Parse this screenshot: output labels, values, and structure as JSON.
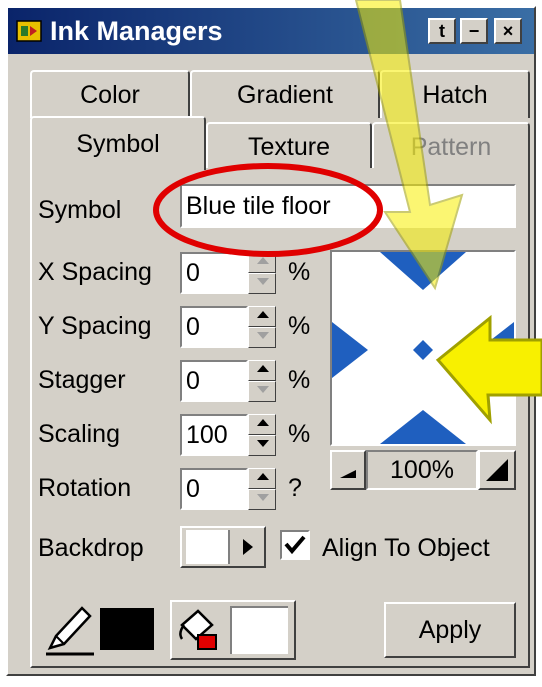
{
  "window": {
    "title": "Ink Managers",
    "icons": {
      "app": "ink-manager-icon",
      "pin": "pin-icon",
      "minimize": "minimize-icon",
      "close": "close-icon"
    },
    "pin_label": "t",
    "minimize_label": "−",
    "close_label": "×"
  },
  "tabs": {
    "back_row": [
      "Color",
      "Gradient",
      "Hatch"
    ],
    "front_row": [
      "Symbol",
      "Texture",
      "Pattern"
    ],
    "active": "Symbol"
  },
  "symbol": {
    "label": "Symbol",
    "value": "Blue tile floor"
  },
  "fields": [
    {
      "label": "X Spacing",
      "value": "0",
      "unit": "%"
    },
    {
      "label": "Y Spacing",
      "value": "0",
      "unit": "%"
    },
    {
      "label": "Stagger",
      "value": "0",
      "unit": "%"
    },
    {
      "label": "Scaling",
      "value": "100",
      "unit": "%"
    },
    {
      "label": "Rotation",
      "value": "0",
      "unit": "?"
    }
  ],
  "preview": {
    "zoom": "100%",
    "zoom_out_icon": "zoom-out-icon",
    "zoom_in_icon": "zoom-in-icon",
    "tile_color": "#1f5fbf"
  },
  "backdrop": {
    "label": "Backdrop",
    "arrow_icon": "triangle-right-icon"
  },
  "align": {
    "label": "Align To Object",
    "checked": true
  },
  "footer": {
    "pen_icon": "pen-icon",
    "pen_color": "#000000",
    "fill_icon": "paint-bucket-icon",
    "fill_color": "#ffffff",
    "apply_label": "Apply"
  },
  "annotations": {
    "circle_color": "#e00000",
    "arrow_color": "#f8f000"
  }
}
